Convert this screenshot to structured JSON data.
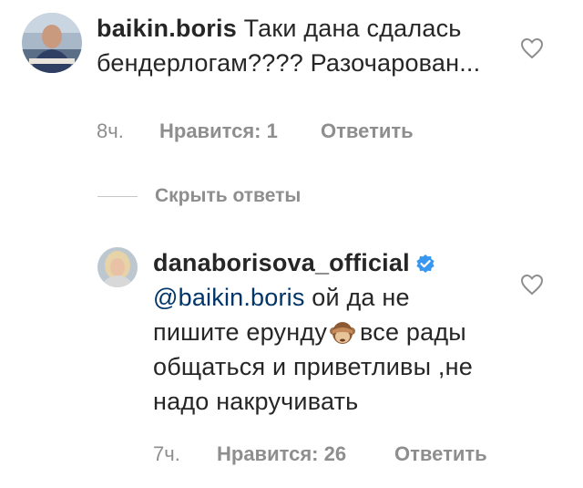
{
  "comments": [
    {
      "username": "baikin.boris",
      "text": "Таки дана сдалась бендерлогам???? Разочарован...",
      "time": "8ч.",
      "likes": "Нравится: 1",
      "reply": "Ответить"
    },
    {
      "username": "danaborisova_official",
      "verified": true,
      "mention": "@baikin.boris",
      "text_before_emoji": "ой да не пишите ерунду",
      "emoji": "see-no-evil-monkey",
      "text_after_emoji": "все рады общаться и приветливы ,не надо накручивать",
      "time": "7ч.",
      "likes": "Нравится: 26",
      "reply": "Ответить"
    }
  ],
  "replies_toggle": "Скрыть ответы",
  "colors": {
    "text": "#262626",
    "muted": "#8e8e8e",
    "mention": "#003569",
    "verified": "#3897f0"
  }
}
